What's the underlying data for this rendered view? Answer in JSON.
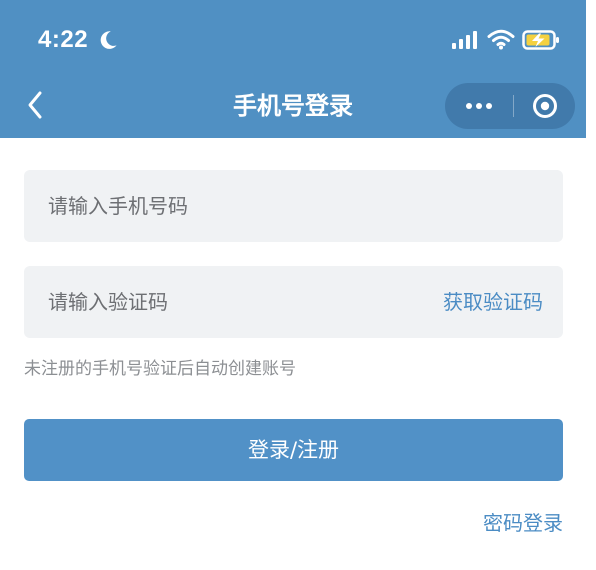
{
  "colors": {
    "header_background": "#5090c3",
    "capsule_background": "#417aab",
    "field_background": "#f0f2f4",
    "primary_button": "#5191c7",
    "link": "#4b8cc4",
    "placeholder_text": "#6d6f73",
    "hint_text": "#8c8f93",
    "battery_fill": "#f4d140"
  },
  "status_bar": {
    "time": "4:22",
    "icons": [
      "moon-icon",
      "signal-icon",
      "wifi-icon",
      "battery-charging-icon"
    ]
  },
  "nav_bar": {
    "back_icon": "chevron-left-icon",
    "title": "手机号登录",
    "capsule_icons": [
      "more-dots-icon",
      "close-target-icon"
    ]
  },
  "form": {
    "phone_placeholder": "请输入手机号码",
    "code_placeholder": "请输入验证码",
    "get_code_label": "获取验证码",
    "hint": "未注册的手机号验证后自动创建账号",
    "submit_label": "登录/注册",
    "password_login_label": "密码登录"
  }
}
